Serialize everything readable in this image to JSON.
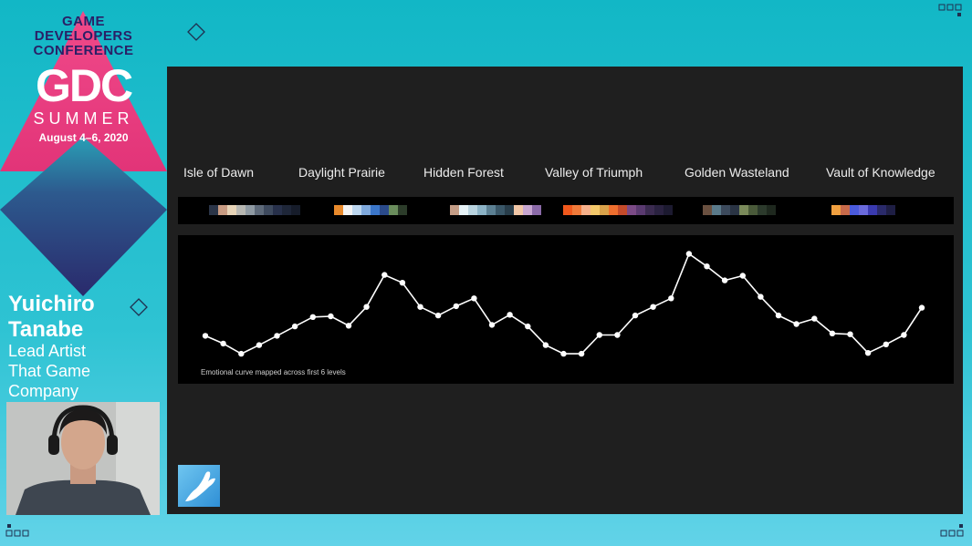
{
  "brand": {
    "line1": "GAME",
    "line2": "DEVELOPERS",
    "line3": "CONFERENCE",
    "logo": "GDC",
    "edition": "SUMMER",
    "dates": "August 4–6, 2020",
    "colors": {
      "pink": "#e8327e",
      "navy": "#2a1f66",
      "teal": "#12b7c6"
    }
  },
  "speaker": {
    "first_name": "Yuichiro",
    "last_name": "Tanabe",
    "role_line1": "Lead Artist",
    "role_line2": "That Game",
    "role_line3": "Company"
  },
  "slide": {
    "levels": [
      {
        "name": "Isle of Dawn",
        "palette": [
          "#2b3548",
          "#c89b82",
          "#e6d3b7",
          "#b7b7b2",
          "#8f9aa3",
          "#5e6a7a",
          "#3e4a5e",
          "#27304a",
          "#1e2638",
          "#161c2a"
        ]
      },
      {
        "name": "Daylight Prairie",
        "palette": [
          "#e88a2c",
          "#f3f3f3",
          "#bcd6ee",
          "#7fa9dc",
          "#3b76c9",
          "#2a4a8a",
          "#6a8d5c",
          "#2c3c2a"
        ]
      },
      {
        "name": "Hidden Forest",
        "palette": [
          "#c49d86",
          "#e6f2f6",
          "#b8d3df",
          "#8cb3c6",
          "#5c8093",
          "#3a5768",
          "#283d4a",
          "#f0c6a6",
          "#c7a6d0",
          "#8b6aa8"
        ]
      },
      {
        "name": "Valley of Triumph",
        "palette": [
          "#f0581c",
          "#f07a3a",
          "#f6b08a",
          "#f3c86a",
          "#d9a24a",
          "#ee6e2e",
          "#c44a2a",
          "#7b4a86",
          "#5a3a70",
          "#3b2b50",
          "#2a2240",
          "#1c1a30"
        ]
      },
      {
        "name": "Golden Wasteland",
        "palette": [
          "#6a5040",
          "#5a7a8a",
          "#3c4a5c",
          "#2a3444",
          "#7a8a5a",
          "#4a5a3a",
          "#2c3a2c",
          "#1e281e"
        ]
      },
      {
        "name": "Vault of Knowledge",
        "palette": [
          "#f0a040",
          "#c86a4a",
          "#4a5adc",
          "#6a6adc",
          "#3a3ab0",
          "#2a2a6a",
          "#1e1e44"
        ]
      }
    ],
    "curve_caption": "Emotional curve mapped across first 6 levels"
  },
  "chart_data": {
    "type": "line",
    "title": "",
    "caption": "Emotional curve mapped across first 6 levels",
    "xlabel": "",
    "ylabel": "",
    "x": [
      1,
      2,
      3,
      4,
      5,
      6,
      7,
      8,
      9,
      10,
      11,
      12,
      13,
      14,
      15,
      16,
      17,
      18,
      19,
      20,
      21,
      22,
      23,
      24,
      25,
      26,
      27,
      28,
      29,
      30,
      31,
      32,
      33,
      34,
      35,
      36,
      37,
      38,
      39,
      40,
      41,
      42
    ],
    "series": [
      {
        "values": [
          5.8,
          4.8,
          3.5,
          4.6,
          5.8,
          7.0,
          8.2,
          8.3,
          7.1,
          9.5,
          13.6,
          12.6,
          9.5,
          8.4,
          9.6,
          10.6,
          7.2,
          8.5,
          7.0,
          4.6,
          3.5,
          3.5,
          5.9,
          5.9,
          8.4,
          9.5,
          10.6,
          16.3,
          14.7,
          12.9,
          13.5,
          10.8,
          8.4,
          7.3,
          8.0,
          6.1,
          6.0,
          3.6,
          4.7,
          5.9,
          9.4
        ]
      }
    ],
    "ylim": [
      0,
      18
    ],
    "grid": false,
    "line_color": "#ffffff"
  },
  "icons": {
    "logo": "hand-reaching-logo"
  }
}
